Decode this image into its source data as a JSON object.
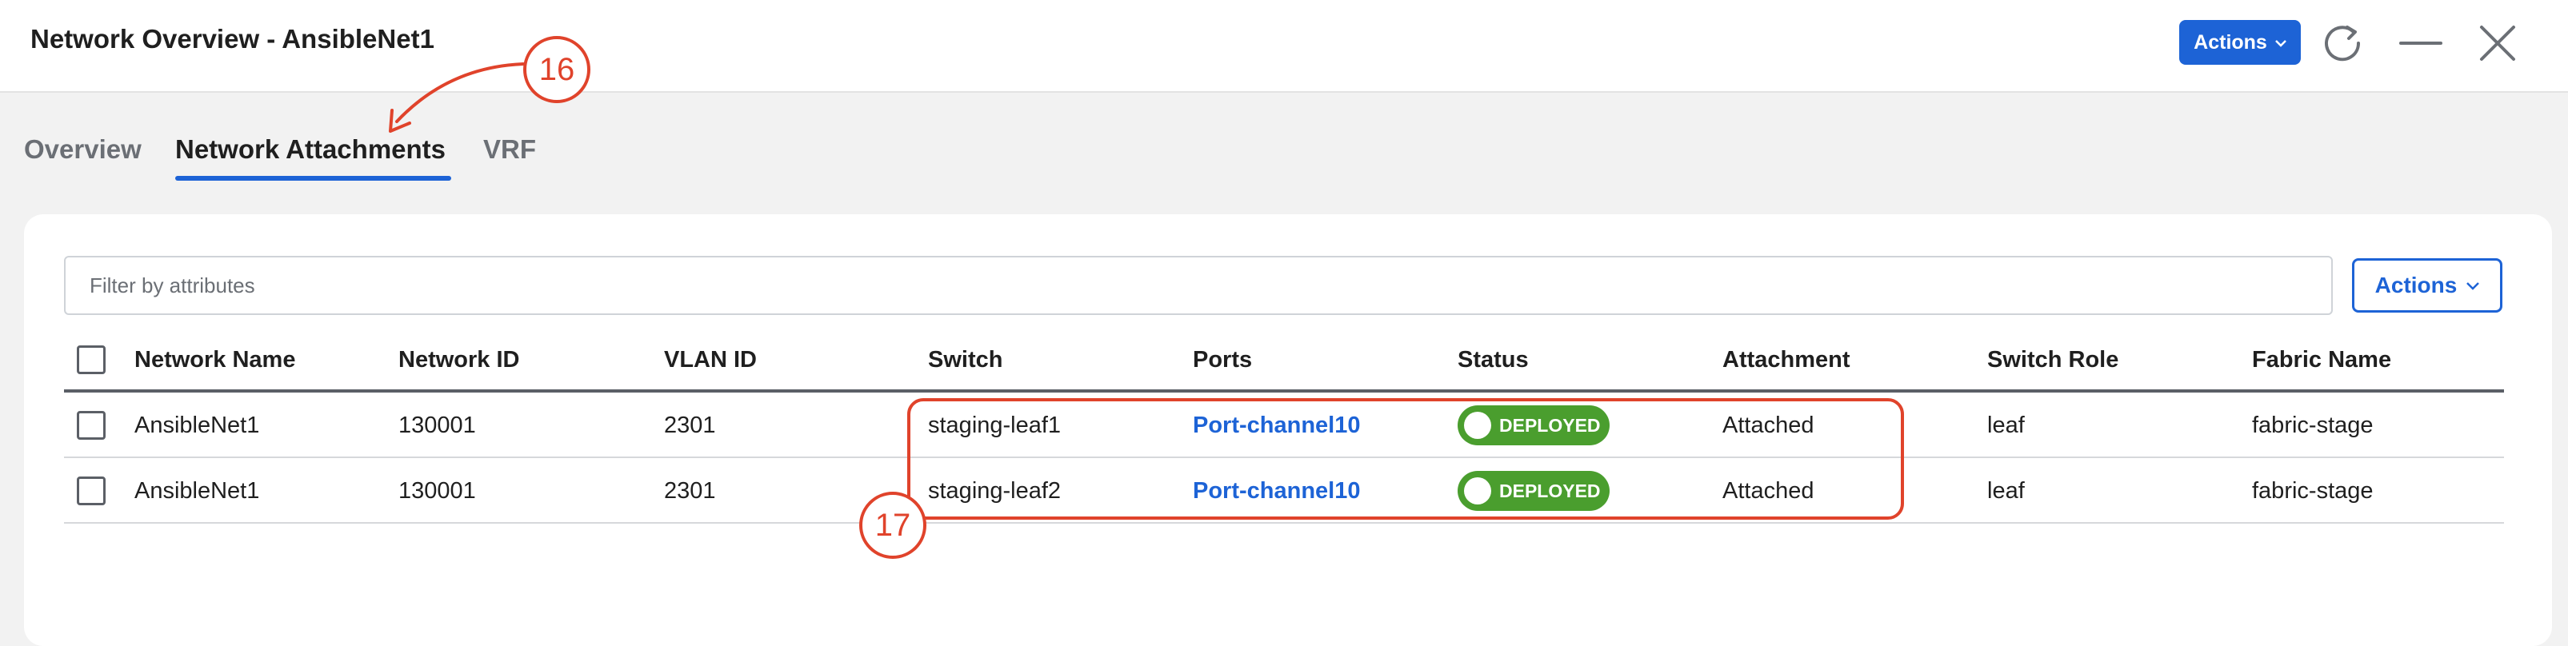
{
  "header": {
    "title": "Network Overview - AnsibleNet1",
    "actions_label": "Actions",
    "icons": [
      "chevron-down-icon",
      "refresh-icon",
      "minimize-icon",
      "close-icon"
    ]
  },
  "tabs": [
    {
      "label": "Overview",
      "active": false
    },
    {
      "label": "Network Attachments",
      "active": true
    },
    {
      "label": "VRF",
      "active": false
    }
  ],
  "filter": {
    "placeholder": "Filter by attributes"
  },
  "table_actions_label": "Actions",
  "table": {
    "columns": [
      "Network Name",
      "Network ID",
      "VLAN ID",
      "Switch",
      "Ports",
      "Status",
      "Attachment",
      "Switch Role",
      "Fabric Name"
    ],
    "rows": [
      {
        "network_name": "AnsibleNet1",
        "network_id": "130001",
        "vlan_id": "2301",
        "switch": "staging-leaf1",
        "ports": "Port-channel10",
        "status": "DEPLOYED",
        "attachment": "Attached",
        "switch_role": "leaf",
        "fabric_name": "fabric-stage"
      },
      {
        "network_name": "AnsibleNet1",
        "network_id": "130001",
        "vlan_id": "2301",
        "switch": "staging-leaf2",
        "ports": "Port-channel10",
        "status": "DEPLOYED",
        "attachment": "Attached",
        "switch_role": "leaf",
        "fabric_name": "fabric-stage"
      }
    ]
  },
  "callouts": [
    "16",
    "17"
  ],
  "colors": {
    "accent": "#1d63d6",
    "deployed": "#4a9e2e",
    "callout": "#e0432b"
  }
}
